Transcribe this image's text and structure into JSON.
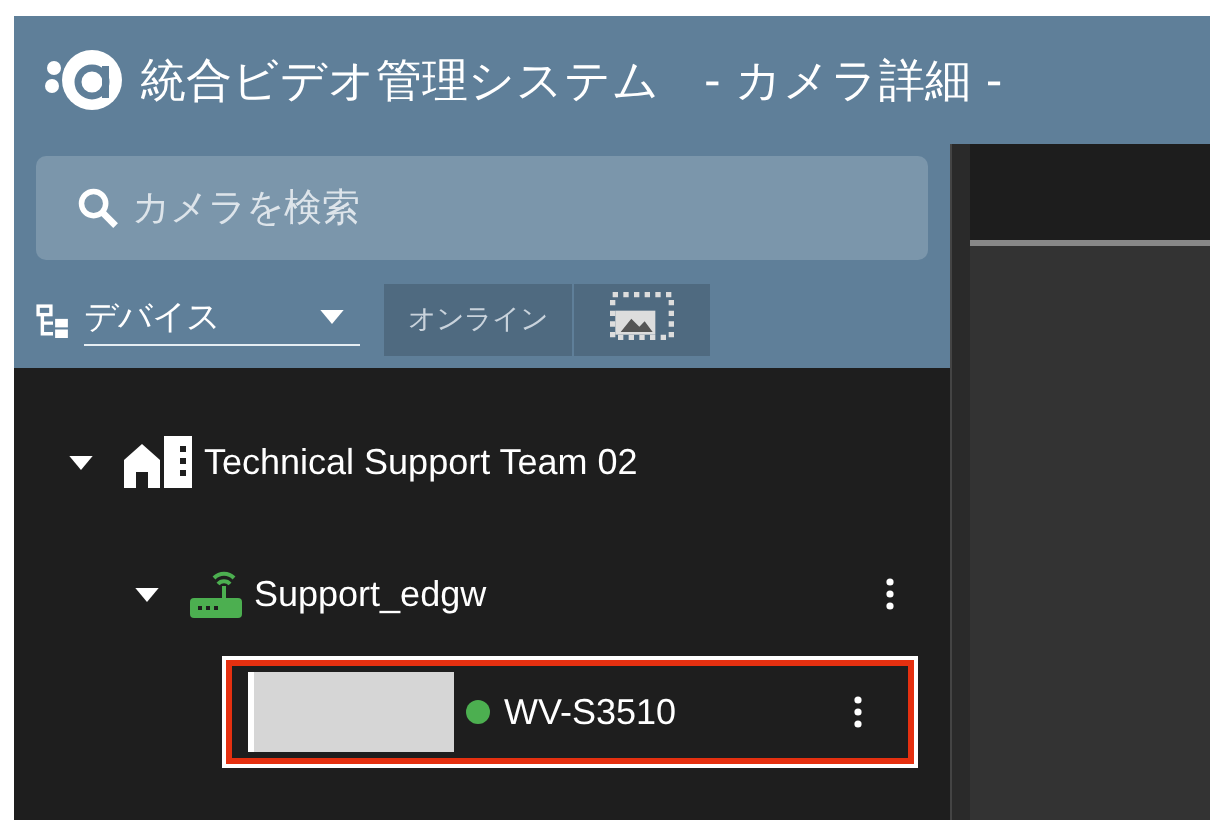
{
  "header": {
    "title": "統合ビデオ管理システム",
    "subtitle": "- カメラ詳細 -"
  },
  "search": {
    "placeholder": "カメラを検索"
  },
  "filter": {
    "value": "デバイス",
    "toggles": [
      {
        "kind": "text",
        "label": "オンライン",
        "selected": false
      },
      {
        "kind": "image",
        "selected": false
      }
    ]
  },
  "tree": [
    {
      "kind": "site",
      "label": "Technical Support Team 02",
      "expanded": true,
      "children": [
        {
          "kind": "gateway",
          "label": "Support_edgw",
          "expanded": true,
          "children": [
            {
              "kind": "camera",
              "label": "WV-S3510",
              "selected": true,
              "color": "#4caf50"
            }
          ]
        }
      ]
    }
  ]
}
